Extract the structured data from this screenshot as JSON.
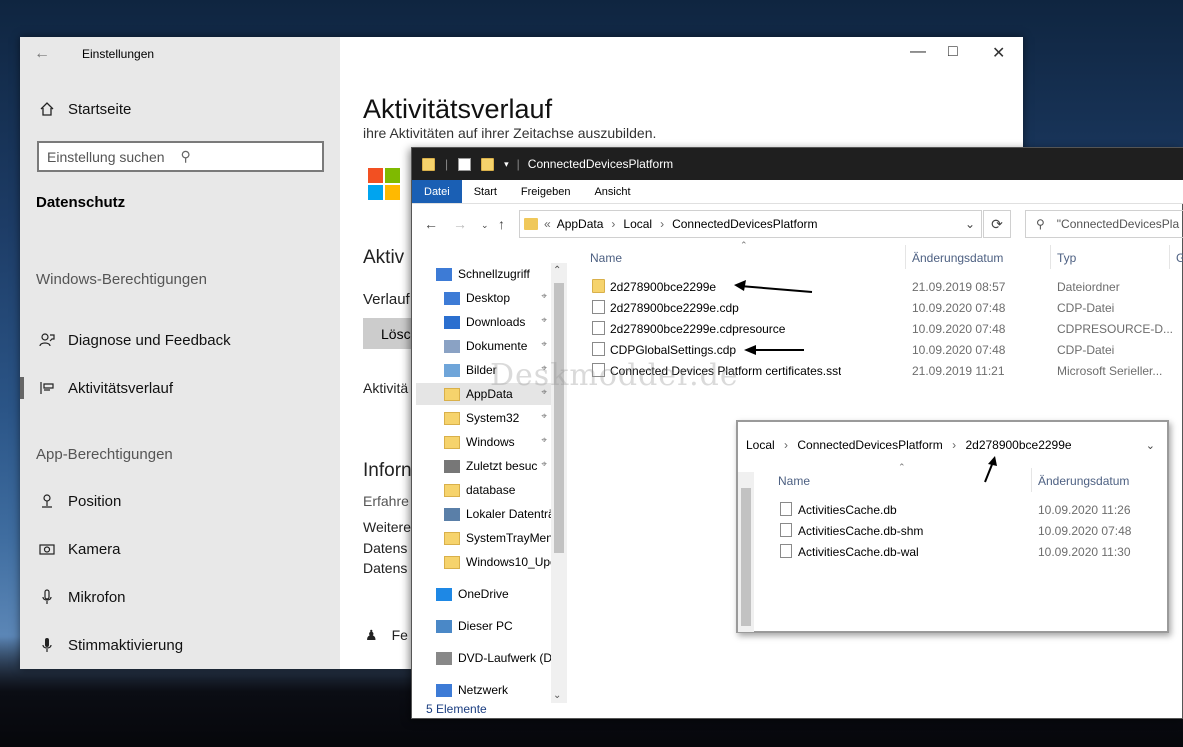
{
  "settings": {
    "window_title": "Einstellungen",
    "home": "Startseite",
    "search_placeholder": "Einstellung suchen",
    "section_privacy": "Datenschutz",
    "section_windows": "Windows-Berechtigungen",
    "nav_diag": "Diagnose und Feedback",
    "nav_activity": "Aktivitätsverlauf",
    "section_app": "App-Berechtigungen",
    "nav_position": "Position",
    "nav_camera": "Kamera",
    "nav_mic": "Mikrofon",
    "nav_voice": "Stimmaktivierung",
    "page_title": "Aktivitätsverlauf",
    "subtext": "ihre Aktivitäten auf ihrer Zeitachse auszubilden.",
    "frag_aktiv": "Aktiv",
    "frag_verlauf": "Verlauf",
    "frag_loesch": "Lösc",
    "frag_aktivitaet": "Aktivitä",
    "frag_inform": "Inforn",
    "frag_erfahre": "Erfahre",
    "frag_weitere": "Weitere",
    "frag_daten1": "Datens",
    "frag_daten2": "Datens",
    "frag_fe": "Fe",
    "icons": {
      "back": "back-arrow-icon",
      "home": "home-icon",
      "search": "search-icon",
      "diag": "feedback-icon",
      "activity": "timeline-icon",
      "position": "location-icon",
      "camera": "camera-icon",
      "mic": "microphone-icon",
      "voice": "voice-activation-icon"
    }
  },
  "explorer": {
    "title": "ConnectedDevicesPlatform",
    "ribbon": [
      "Datei",
      "Start",
      "Freigeben",
      "Ansicht"
    ],
    "path": [
      "AppData",
      "Local",
      "ConnectedDevicesPlatform"
    ],
    "path_prefix": "«",
    "search_placeholder": "\"ConnectedDevicesPla",
    "columns": {
      "name": "Name",
      "date": "Änderungsdatum",
      "type": "Typ",
      "size": "G"
    },
    "nav": [
      {
        "label": "Schnellzugriff",
        "icon": "star-icon"
      },
      {
        "label": "Desktop",
        "icon": "desktop-icon"
      },
      {
        "label": "Downloads",
        "icon": "download-icon"
      },
      {
        "label": "Dokumente",
        "icon": "documents-icon"
      },
      {
        "label": "Bilder",
        "icon": "pictures-icon"
      },
      {
        "label": "AppData",
        "icon": "folder-icon"
      },
      {
        "label": "System32",
        "icon": "folder-icon"
      },
      {
        "label": "Windows",
        "icon": "folder-icon"
      },
      {
        "label": "Zuletzt besuc",
        "icon": "recent-icon"
      },
      {
        "label": "database",
        "icon": "folder-icon"
      },
      {
        "label": "Lokaler Datenträ",
        "icon": "drive-icon"
      },
      {
        "label": "SystemTrayMenu",
        "icon": "folder-icon"
      },
      {
        "label": "Windows10_Upc",
        "icon": "folder-icon"
      },
      {
        "label": "OneDrive",
        "icon": "cloud-icon"
      },
      {
        "label": "Dieser PC",
        "icon": "computer-icon"
      },
      {
        "label": "DVD-Laufwerk (D:",
        "icon": "dvd-icon"
      },
      {
        "label": "Netzwerk",
        "icon": "network-icon"
      }
    ],
    "files": [
      {
        "name": "2d278900bce2299e",
        "date": "21.09.2019 08:57",
        "type": "Dateiordner",
        "kind": "folder"
      },
      {
        "name": "2d278900bce2299e.cdp",
        "date": "10.09.2020 07:48",
        "type": "CDP-Datei",
        "kind": "file"
      },
      {
        "name": "2d278900bce2299e.cdpresource",
        "date": "10.09.2020 07:48",
        "type": "CDPRESOURCE-D...",
        "kind": "file"
      },
      {
        "name": "CDPGlobalSettings.cdp",
        "date": "10.09.2020 07:48",
        "type": "CDP-Datei",
        "kind": "file"
      },
      {
        "name": "Connected Devices Platform certificates.sst",
        "date": "21.09.2019 11:21",
        "type": "Microsoft Serieller...",
        "kind": "file"
      }
    ],
    "status": "5 Elemente"
  },
  "inset": {
    "path": [
      "Local",
      "ConnectedDevicesPlatform",
      "2d278900bce2299e"
    ],
    "columns": {
      "name": "Name",
      "date": "Änderungsdatum"
    },
    "files": [
      {
        "name": "ActivitiesCache.db",
        "date": "10.09.2020 11:26"
      },
      {
        "name": "ActivitiesCache.db-shm",
        "date": "10.09.2020 07:48"
      },
      {
        "name": "ActivitiesCache.db-wal",
        "date": "10.09.2020 11:30"
      }
    ]
  },
  "watermark": "Deskmodder.de",
  "colors": {
    "accent": "#1a5fb4",
    "folder": "#f6d36c",
    "titlebar": "#1f1f1f"
  }
}
